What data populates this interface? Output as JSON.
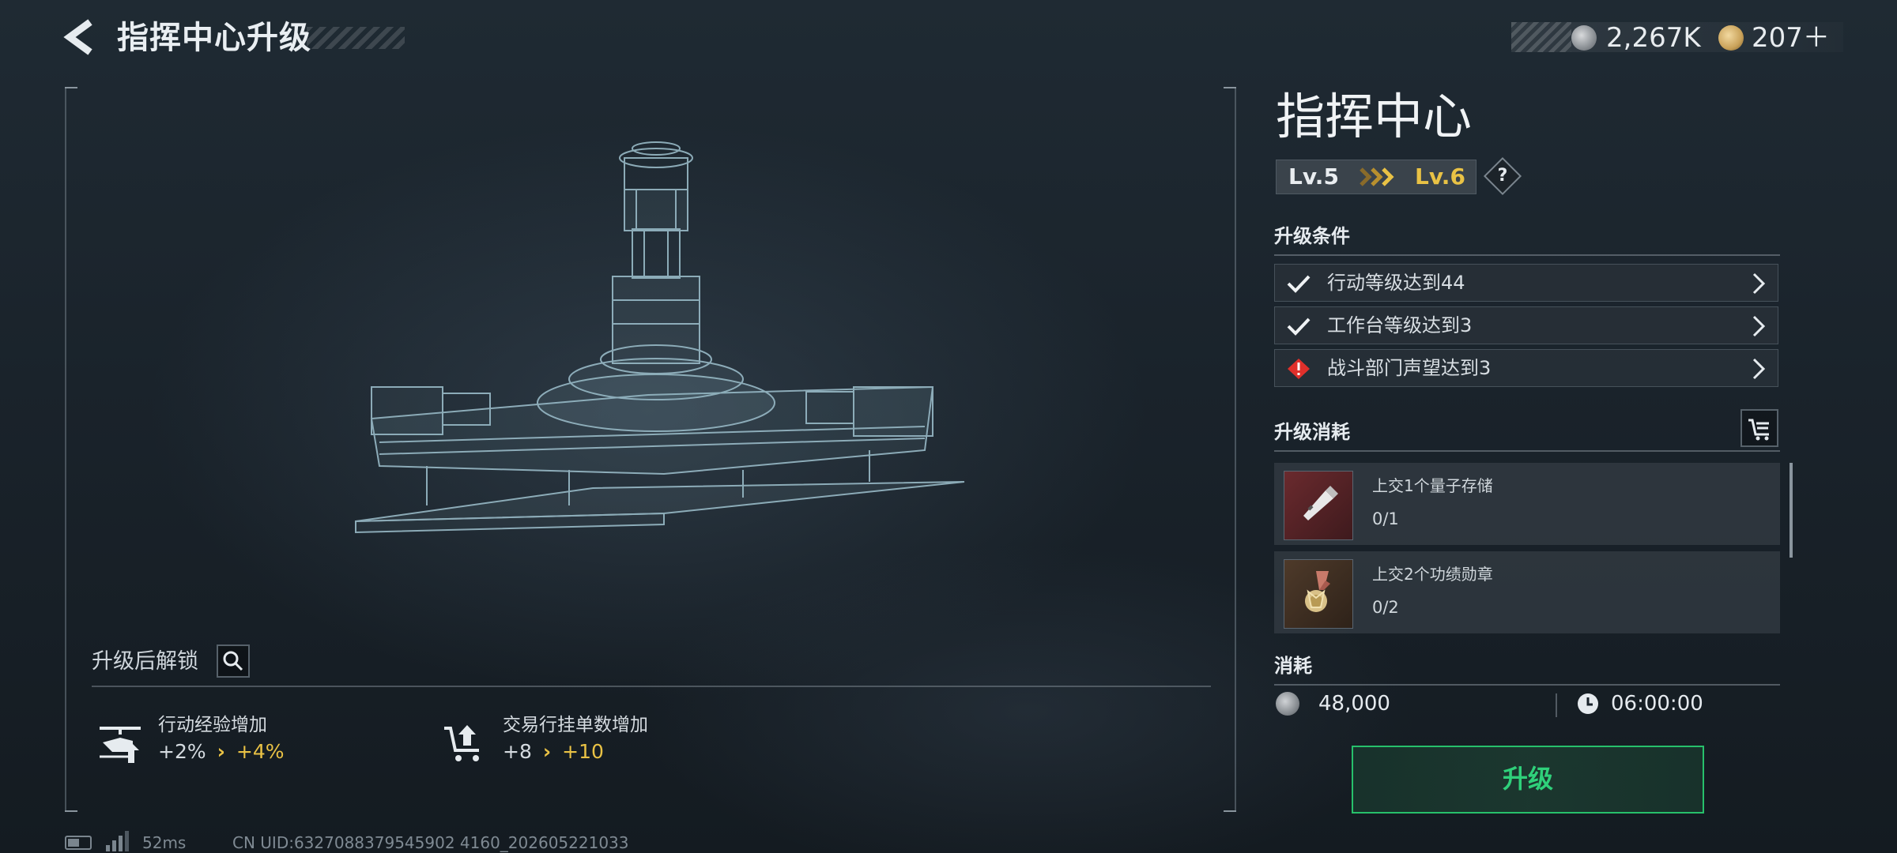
{
  "header": {
    "title": "指挥中心升级",
    "currency": [
      {
        "icon": "silver-coin-icon",
        "amount": "2,267K"
      },
      {
        "icon": "gold-coin-icon",
        "amount": "207＋"
      }
    ]
  },
  "building": {
    "name": "指挥中心",
    "level_current": "Lv.5",
    "level_next": "Lv.6",
    "help_label": "?"
  },
  "conditions": {
    "title": "升级条件",
    "items": [
      {
        "text": "行动等级达到44",
        "status": "met"
      },
      {
        "text": "工作台等级达到3",
        "status": "met"
      },
      {
        "text": "战斗部门声望达到3",
        "status": "unmet"
      }
    ]
  },
  "costs": {
    "title": "升级消耗",
    "items": [
      {
        "name": "上交1个量子存储",
        "count": "0/1"
      },
      {
        "name": "上交2个功绩勋章",
        "count": "0/2"
      }
    ]
  },
  "consume": {
    "title": "消耗",
    "amount": "48,000",
    "time": "06:00:00"
  },
  "upgrade_button": {
    "label": "升级"
  },
  "unlock": {
    "title": "升级后解锁",
    "items": [
      {
        "label": "行动经验增加",
        "from": "+2%",
        "to": "+4%"
      },
      {
        "label": "交易行挂单数增加",
        "from": "+8",
        "to": "+10"
      }
    ]
  },
  "status": {
    "ping": "52ms",
    "uid": "CN UID:6327088379545902 4160_202605221033"
  },
  "colors": {
    "accent_yellow": "#e9c245",
    "accent_green": "#2fd07a",
    "warning_red": "#e0302b"
  }
}
